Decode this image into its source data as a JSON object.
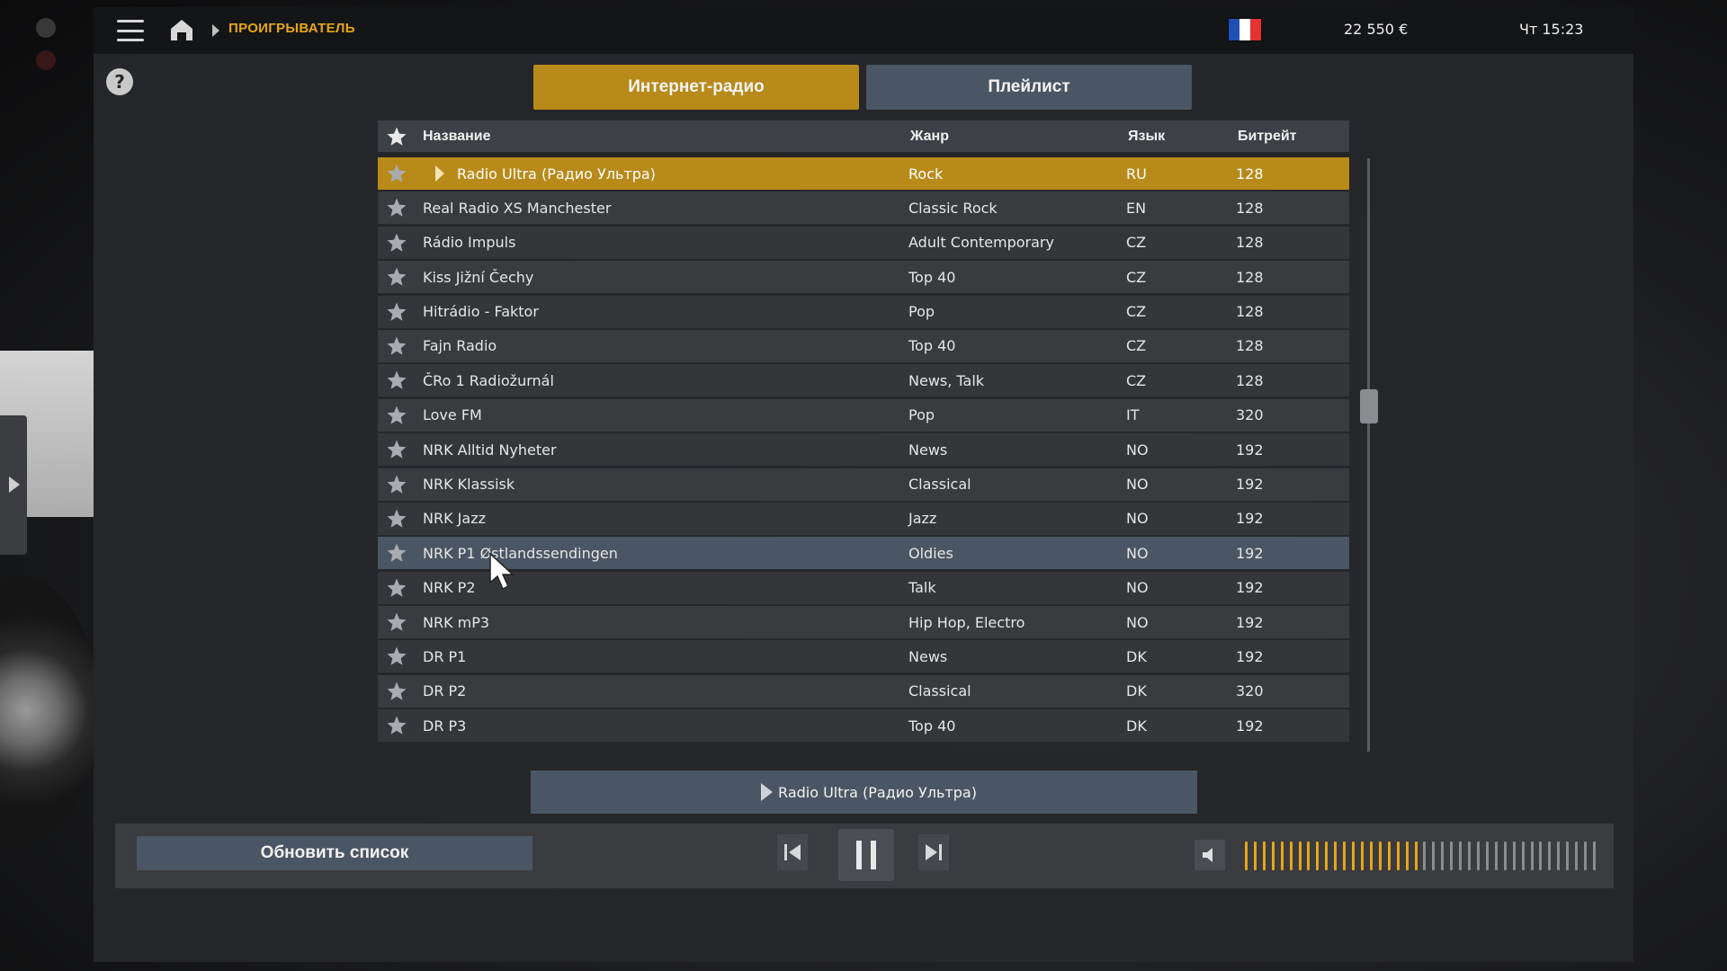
{
  "header": {
    "breadcrumb": "ПРОИГРЫВАТЕЛЬ",
    "money": "22 550 €",
    "clock": "Чт 15:23",
    "flag_colors": [
      "#1f4fb4",
      "#ffffff",
      "#e53232"
    ]
  },
  "tabs": [
    {
      "label": "Интернет-радио",
      "active": true
    },
    {
      "label": "Плейлист",
      "active": false
    }
  ],
  "table": {
    "columns": {
      "name": "Название",
      "genre": "Жанр",
      "lang": "Язык",
      "bitrate": "Битрейт"
    },
    "rows": [
      {
        "name": "Radio Ultra (Радио Ультра)",
        "genre": "Rock",
        "lang": "RU",
        "bitrate": "128",
        "state": "playing"
      },
      {
        "name": "Real Radio XS Manchester",
        "genre": "Classic Rock",
        "lang": "EN",
        "bitrate": "128"
      },
      {
        "name": "Rádio Impuls",
        "genre": "Adult Contemporary",
        "lang": "CZ",
        "bitrate": "128"
      },
      {
        "name": "Kiss Jižní Čechy",
        "genre": "Top 40",
        "lang": "CZ",
        "bitrate": "128"
      },
      {
        "name": "Hitrádio - Faktor",
        "genre": "Pop",
        "lang": "CZ",
        "bitrate": "128"
      },
      {
        "name": "Fajn Radio",
        "genre": "Top 40",
        "lang": "CZ",
        "bitrate": "128"
      },
      {
        "name": "ČRo 1 Radiožurnál",
        "genre": "News, Talk",
        "lang": "CZ",
        "bitrate": "128"
      },
      {
        "name": "Love FM",
        "genre": "Pop",
        "lang": "IT",
        "bitrate": "320"
      },
      {
        "name": "NRK Alltid Nyheter",
        "genre": "News",
        "lang": "NO",
        "bitrate": "192"
      },
      {
        "name": "NRK Klassisk",
        "genre": "Classical",
        "lang": "NO",
        "bitrate": "192"
      },
      {
        "name": "NRK Jazz",
        "genre": "Jazz",
        "lang": "NO",
        "bitrate": "192"
      },
      {
        "name": "NRK P1 Østlandssendingen",
        "genre": "Oldies",
        "lang": "NO",
        "bitrate": "192",
        "state": "hover"
      },
      {
        "name": "NRK P2",
        "genre": "Talk",
        "lang": "NO",
        "bitrate": "192"
      },
      {
        "name": "NRK mP3",
        "genre": "Hip Hop, Electro",
        "lang": "NO",
        "bitrate": "192"
      },
      {
        "name": "DR P1",
        "genre": "News",
        "lang": "DK",
        "bitrate": "192"
      },
      {
        "name": "DR P2",
        "genre": "Classical",
        "lang": "DK",
        "bitrate": "320"
      },
      {
        "name": "DR P3",
        "genre": "Top 40",
        "lang": "DK",
        "bitrate": "192"
      }
    ]
  },
  "now_playing": {
    "title": "Radio Ultra (Радио Ультра)"
  },
  "controls": {
    "refresh_label": "Обновить список",
    "volume_level": 0.5,
    "volume_segments": 40
  },
  "colors": {
    "accent": "#b88a1a",
    "accent_text": "#e6a619",
    "tab_inactive": "#4a5663",
    "row_hover": "#4a5663"
  },
  "icons": [
    "menu-icon",
    "home-icon",
    "help-icon",
    "star-icon",
    "play-icon",
    "previous-icon",
    "pause-icon",
    "next-icon",
    "speaker-icon"
  ]
}
